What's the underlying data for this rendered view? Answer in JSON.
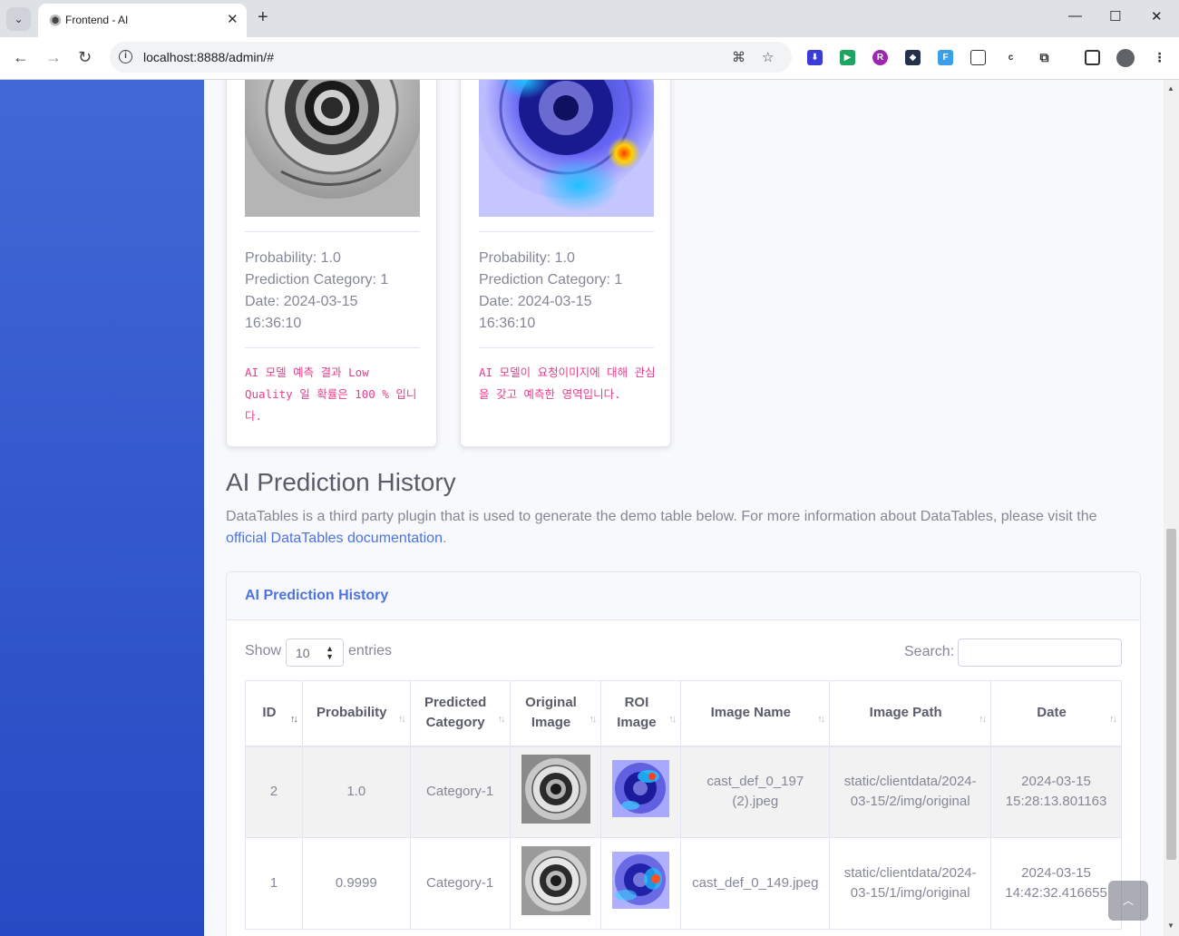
{
  "browser": {
    "tab_title": "Frontend - AI",
    "url": "localhost:8888/admin/#",
    "new_tab_label": "+",
    "tab_close_label": "✕"
  },
  "cards": [
    {
      "image_kind": "original",
      "probability": "Probability: 1.0",
      "category": "Prediction Category: 1",
      "date": "Date: 2024-03-15",
      "time": "16:36:10",
      "note": "AI 모델 예측 결과 Low Quality 일 확률은 100 % 입니다."
    },
    {
      "image_kind": "roi",
      "probability": "Probability: 1.0",
      "category": "Prediction Category: 1",
      "date": "Date: 2024-03-15",
      "time": "16:36:10",
      "note": "AI 모델이 요청이미지에 대해 관심을 갖고 예측한 영역입니다."
    }
  ],
  "history": {
    "title": "AI Prediction History",
    "description": "DataTables is a third party plugin that is used to generate the demo table below. For more information about DataTables, please visit the",
    "link_text": "official DataTables documentation",
    "link_suffix": "."
  },
  "datatable": {
    "card_title": "AI Prediction History",
    "show_label": "Show",
    "page_length": "10",
    "entries_label": "entries",
    "search_label": "Search:",
    "search_value": "",
    "columns": [
      {
        "l1": "ID",
        "l2": ""
      },
      {
        "l1": "Probability",
        "l2": ""
      },
      {
        "l1": "Predicted",
        "l2": "Category"
      },
      {
        "l1": "Original",
        "l2": "Image"
      },
      {
        "l1": "ROI",
        "l2": "Image"
      },
      {
        "l1": "Image Name",
        "l2": ""
      },
      {
        "l1": "Image Path",
        "l2": ""
      },
      {
        "l1": "Date",
        "l2": ""
      }
    ],
    "rows": [
      {
        "id": "2",
        "probability": "1.0",
        "category": "Category-1",
        "image_name_1": "cast_def_0_197",
        "image_name_2": "(2).jpeg",
        "path_1": "static/clientdata/2024-",
        "path_2": "03-15/2/img/original",
        "date_1": "2024-03-15",
        "date_2": "15:28:13.801163"
      },
      {
        "id": "1",
        "probability": "0.9999",
        "category": "Category-1",
        "image_name_1": "cast_def_0_149.jpeg",
        "image_name_2": "",
        "path_1": "static/clientdata/2024-",
        "path_2": "03-15/1/img/original",
        "date_1": "2024-03-15",
        "date_2": "14:42:32.416655"
      }
    ]
  },
  "colors": {
    "primary": "#4e73df",
    "sidebar_top": "#4268d6",
    "sidebar_bottom": "#2749c3",
    "note_pink": "#e83e8c",
    "text_gray": "#858796"
  }
}
